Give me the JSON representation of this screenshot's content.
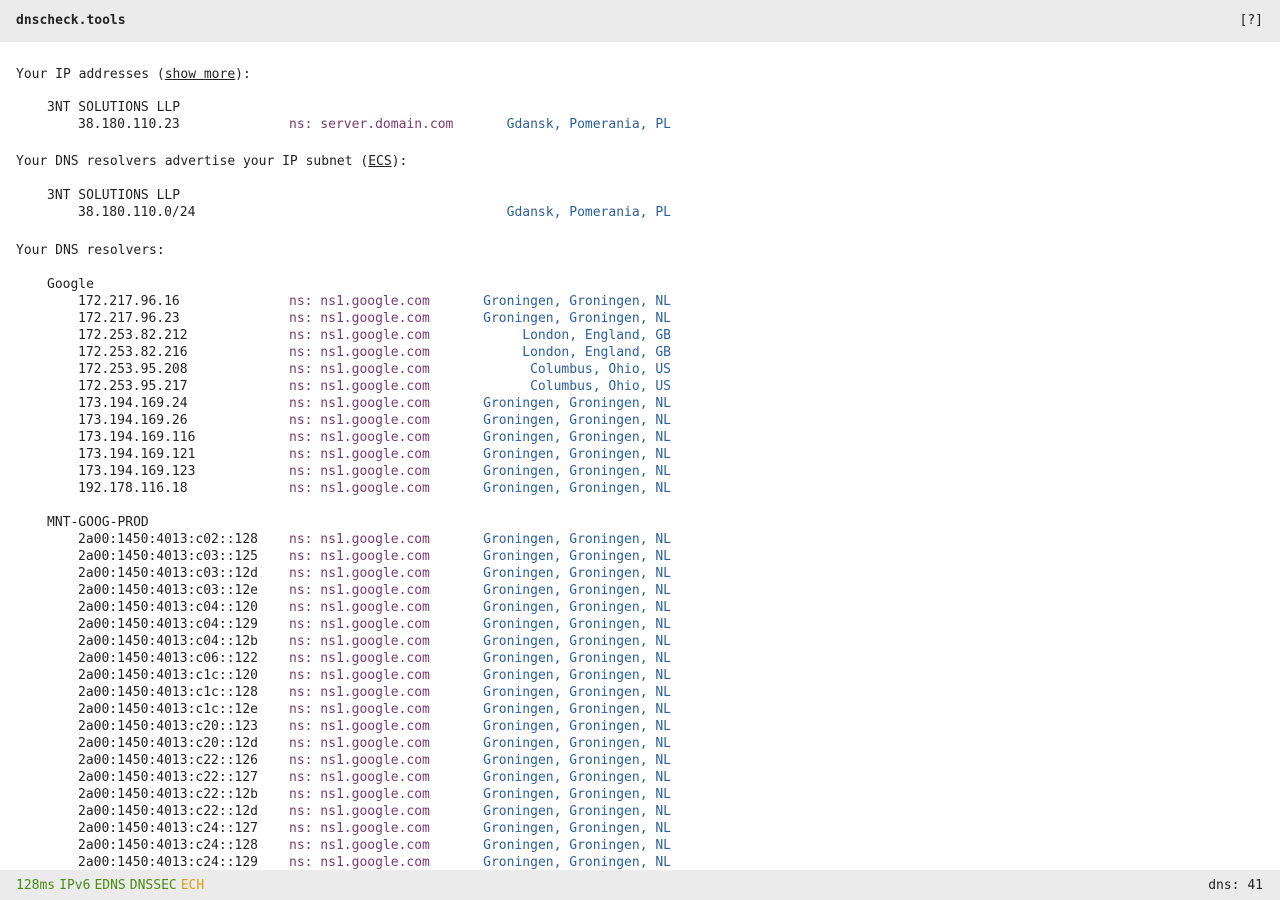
{
  "header": {
    "title": "dnscheck.tools",
    "help_label": "[?]"
  },
  "ip_section": {
    "prefix": "Your IP addresses (",
    "link": "show more",
    "suffix": "):",
    "org": "3NT SOLUTIONS LLP",
    "ip": "38.180.110.23",
    "ns": "ns: server.domain.com",
    "location": "Gdansk, Pomerania, PL"
  },
  "ecs_section": {
    "prefix": "Your DNS resolvers advertise your IP subnet (",
    "link": "ECS",
    "suffix": "):",
    "org": "3NT SOLUTIONS LLP",
    "subnet": "38.180.110.0/24",
    "location": "Gdansk, Pomerania, PL"
  },
  "resolvers_section": {
    "heading": "Your DNS resolvers:",
    "groups": [
      {
        "org": "Google",
        "rows": [
          {
            "ip": "172.217.96.16",
            "ns": "ns: ns1.google.com",
            "location": "Groningen, Groningen, NL"
          },
          {
            "ip": "172.217.96.23",
            "ns": "ns: ns1.google.com",
            "location": "Groningen, Groningen, NL"
          },
          {
            "ip": "172.253.82.212",
            "ns": "ns: ns1.google.com",
            "location": "London, England, GB"
          },
          {
            "ip": "172.253.82.216",
            "ns": "ns: ns1.google.com",
            "location": "London, England, GB"
          },
          {
            "ip": "172.253.95.208",
            "ns": "ns: ns1.google.com",
            "location": "Columbus, Ohio, US"
          },
          {
            "ip": "172.253.95.217",
            "ns": "ns: ns1.google.com",
            "location": "Columbus, Ohio, US"
          },
          {
            "ip": "173.194.169.24",
            "ns": "ns: ns1.google.com",
            "location": "Groningen, Groningen, NL"
          },
          {
            "ip": "173.194.169.26",
            "ns": "ns: ns1.google.com",
            "location": "Groningen, Groningen, NL"
          },
          {
            "ip": "173.194.169.116",
            "ns": "ns: ns1.google.com",
            "location": "Groningen, Groningen, NL"
          },
          {
            "ip": "173.194.169.121",
            "ns": "ns: ns1.google.com",
            "location": "Groningen, Groningen, NL"
          },
          {
            "ip": "173.194.169.123",
            "ns": "ns: ns1.google.com",
            "location": "Groningen, Groningen, NL"
          },
          {
            "ip": "192.178.116.18",
            "ns": "ns: ns1.google.com",
            "location": "Groningen, Groningen, NL"
          }
        ]
      },
      {
        "org": "MNT-GOOG-PROD",
        "rows": [
          {
            "ip": "2a00:1450:4013:c02::128",
            "ns": "ns: ns1.google.com",
            "location": "Groningen, Groningen, NL"
          },
          {
            "ip": "2a00:1450:4013:c03::125",
            "ns": "ns: ns1.google.com",
            "location": "Groningen, Groningen, NL"
          },
          {
            "ip": "2a00:1450:4013:c03::12d",
            "ns": "ns: ns1.google.com",
            "location": "Groningen, Groningen, NL"
          },
          {
            "ip": "2a00:1450:4013:c03::12e",
            "ns": "ns: ns1.google.com",
            "location": "Groningen, Groningen, NL"
          },
          {
            "ip": "2a00:1450:4013:c04::120",
            "ns": "ns: ns1.google.com",
            "location": "Groningen, Groningen, NL"
          },
          {
            "ip": "2a00:1450:4013:c04::129",
            "ns": "ns: ns1.google.com",
            "location": "Groningen, Groningen, NL"
          },
          {
            "ip": "2a00:1450:4013:c04::12b",
            "ns": "ns: ns1.google.com",
            "location": "Groningen, Groningen, NL"
          },
          {
            "ip": "2a00:1450:4013:c06::122",
            "ns": "ns: ns1.google.com",
            "location": "Groningen, Groningen, NL"
          },
          {
            "ip": "2a00:1450:4013:c1c::120",
            "ns": "ns: ns1.google.com",
            "location": "Groningen, Groningen, NL"
          },
          {
            "ip": "2a00:1450:4013:c1c::128",
            "ns": "ns: ns1.google.com",
            "location": "Groningen, Groningen, NL"
          },
          {
            "ip": "2a00:1450:4013:c1c::12e",
            "ns": "ns: ns1.google.com",
            "location": "Groningen, Groningen, NL"
          },
          {
            "ip": "2a00:1450:4013:c20::123",
            "ns": "ns: ns1.google.com",
            "location": "Groningen, Groningen, NL"
          },
          {
            "ip": "2a00:1450:4013:c20::12d",
            "ns": "ns: ns1.google.com",
            "location": "Groningen, Groningen, NL"
          },
          {
            "ip": "2a00:1450:4013:c22::126",
            "ns": "ns: ns1.google.com",
            "location": "Groningen, Groningen, NL"
          },
          {
            "ip": "2a00:1450:4013:c22::127",
            "ns": "ns: ns1.google.com",
            "location": "Groningen, Groningen, NL"
          },
          {
            "ip": "2a00:1450:4013:c22::12b",
            "ns": "ns: ns1.google.com",
            "location": "Groningen, Groningen, NL"
          },
          {
            "ip": "2a00:1450:4013:c22::12d",
            "ns": "ns: ns1.google.com",
            "location": "Groningen, Groningen, NL"
          },
          {
            "ip": "2a00:1450:4013:c24::127",
            "ns": "ns: ns1.google.com",
            "location": "Groningen, Groningen, NL"
          },
          {
            "ip": "2a00:1450:4013:c24::128",
            "ns": "ns: ns1.google.com",
            "location": "Groningen, Groningen, NL"
          },
          {
            "ip": "2a00:1450:4013:c24::129",
            "ns": "ns: ns1.google.com",
            "location": "Groningen, Groningen, NL"
          }
        ]
      }
    ]
  },
  "footer": {
    "tags": [
      {
        "label": "128ms",
        "color": "#4a8a12"
      },
      {
        "label": "IPv6",
        "color": "#4a8a12"
      },
      {
        "label": "EDNS",
        "color": "#4a8a12"
      },
      {
        "label": "DNSSEC",
        "color": "#4a8a12"
      },
      {
        "label": "ECH",
        "color": "#d4a017"
      }
    ],
    "dns_count": "dns: 41"
  }
}
